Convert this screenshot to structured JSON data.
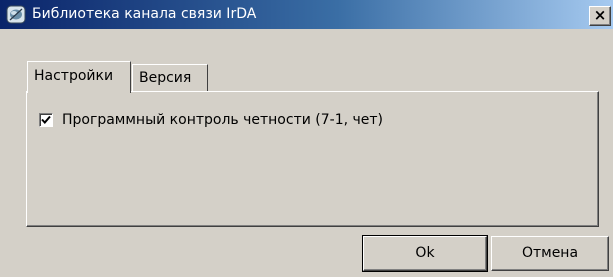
{
  "window": {
    "title": "Библиотека канала связи IrDA",
    "icon": "app-icon",
    "close_label": "×"
  },
  "tabs": [
    {
      "label": "Настройки",
      "active": true
    },
    {
      "label": "Версия",
      "active": false
    }
  ],
  "settings": {
    "parity_checkbox": {
      "label": "Программный контроль четности (7-1, чет)",
      "checked": true
    }
  },
  "buttons": {
    "ok_label": "Ok",
    "cancel_label": "Отмена"
  }
}
